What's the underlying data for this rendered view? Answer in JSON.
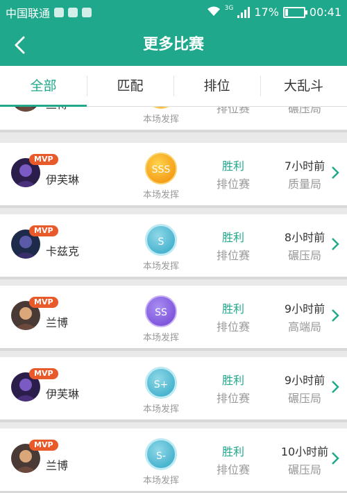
{
  "status_bar": {
    "carrier": "中国联通",
    "network": "3G",
    "battery": "17%",
    "battery_level": 0.17,
    "time": "00:41"
  },
  "header": {
    "title": "更多比赛",
    "back_icon": "chevron-left-icon"
  },
  "tabs": [
    {
      "label": "全部",
      "active": true
    },
    {
      "label": "匹配",
      "active": false
    },
    {
      "label": "排位",
      "active": false
    },
    {
      "label": "大乱斗",
      "active": false
    }
  ],
  "colors": {
    "accent": "#1fa88b",
    "mvp_badge": "#e85a2a"
  },
  "matches": [
    {
      "hero": "兰博",
      "mvp": "",
      "grade": "",
      "grade_label": "本场发挥",
      "result": "",
      "mode": "排位赛",
      "time": "",
      "level": "碾压局"
    },
    {
      "hero": "伊芙琳",
      "mvp": "MVP",
      "grade": "SSS",
      "grade_label": "本场发挥",
      "result": "胜利",
      "mode": "排位赛",
      "time": "7小时前",
      "level": "质量局"
    },
    {
      "hero": "卡兹克",
      "mvp": "MVP",
      "grade": "S",
      "grade_label": "本场发挥",
      "result": "胜利",
      "mode": "排位赛",
      "time": "8小时前",
      "level": "碾压局"
    },
    {
      "hero": "兰博",
      "mvp": "MVP",
      "grade": "SS",
      "grade_label": "本场发挥",
      "result": "胜利",
      "mode": "排位赛",
      "time": "9小时前",
      "level": "高端局"
    },
    {
      "hero": "伊芙琳",
      "mvp": "MVP",
      "grade": "S+",
      "grade_label": "本场发挥",
      "result": "胜利",
      "mode": "排位赛",
      "time": "9小时前",
      "level": "碾压局"
    },
    {
      "hero": "兰博",
      "mvp": "MVP",
      "grade": "S-",
      "grade_label": "本场发挥",
      "result": "胜利",
      "mode": "排位赛",
      "time": "10小时前",
      "level": "碾压局"
    }
  ]
}
